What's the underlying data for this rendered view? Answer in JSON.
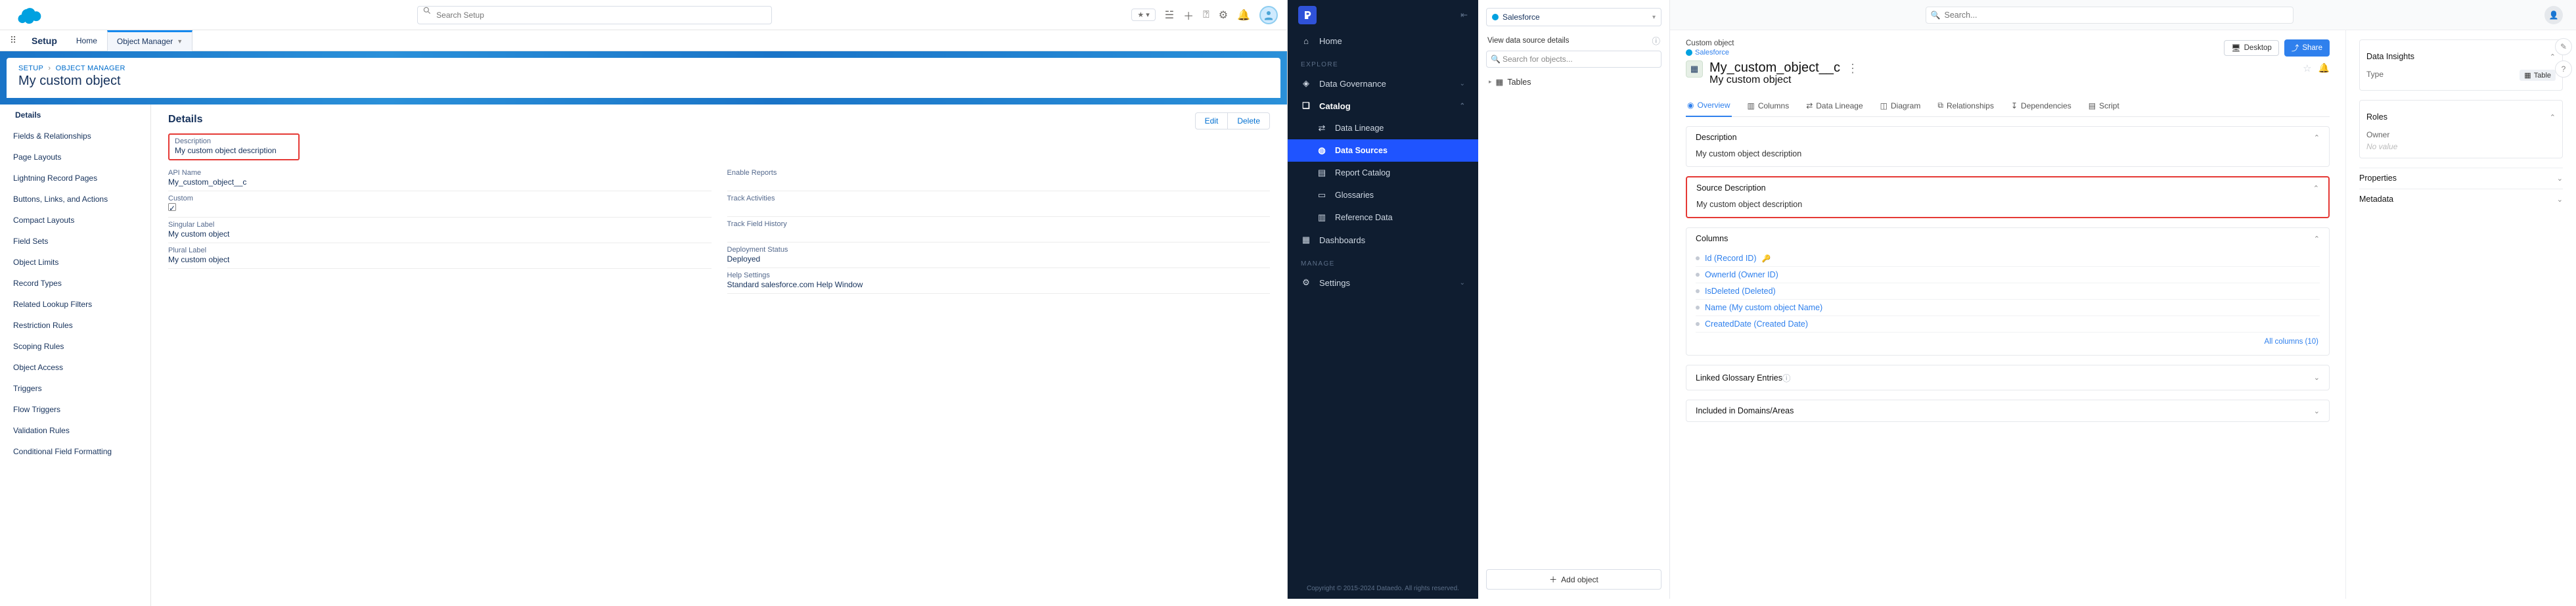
{
  "salesforce": {
    "search_placeholder": "Search Setup",
    "app_name": "Setup",
    "top_tabs": {
      "home": "Home",
      "object_manager": "Object Manager"
    },
    "star_pill": "★ ▾",
    "breadcrumb": {
      "setup": "SETUP",
      "om": "OBJECT MANAGER"
    },
    "object_title": "My custom object",
    "side_items": [
      "Details",
      "Fields & Relationships",
      "Page Layouts",
      "Lightning Record Pages",
      "Buttons, Links, and Actions",
      "Compact Layouts",
      "Field Sets",
      "Object Limits",
      "Record Types",
      "Related Lookup Filters",
      "Restriction Rules",
      "Scoping Rules",
      "Object Access",
      "Triggers",
      "Flow Triggers",
      "Validation Rules",
      "Conditional Field Formatting"
    ],
    "section_title": "Details",
    "actions": {
      "edit": "Edit",
      "delete": "Delete"
    },
    "fields": {
      "description": {
        "label": "Description",
        "value": "My custom object description"
      },
      "api_name": {
        "label": "API Name",
        "value": "My_custom_object__c"
      },
      "custom": {
        "label": "Custom"
      },
      "singular": {
        "label": "Singular Label",
        "value": "My custom object"
      },
      "plural": {
        "label": "Plural Label",
        "value": "My custom object"
      },
      "enable_reports": {
        "label": "Enable Reports"
      },
      "track_activities": {
        "label": "Track Activities"
      },
      "track_history": {
        "label": "Track Field History"
      },
      "deploy": {
        "label": "Deployment Status",
        "value": "Deployed"
      },
      "help": {
        "label": "Help Settings",
        "value": "Standard salesforce.com Help Window"
      }
    }
  },
  "alation": {
    "nav": {
      "home": "Home",
      "explore": "EXPLORE",
      "data_gov": "Data Governance",
      "catalog": "Catalog",
      "data_lineage": "Data Lineage",
      "data_sources": "Data Sources",
      "report_catalog": "Report Catalog",
      "glossaries": "Glossaries",
      "reference_data": "Reference Data",
      "dashboards": "Dashboards",
      "manage": "MANAGE",
      "settings": "Settings",
      "footer": "Copyright © 2015-2024 Dataedo. All rights reserved."
    },
    "search_placeholder": "Search...",
    "obj_panel": {
      "source": "Salesforce",
      "header": "View data source details",
      "search_placeholder": "Search for objects...",
      "tables_node": "Tables",
      "add_object": "Add object"
    },
    "header": {
      "type_label": "Custom object",
      "source_crumb": "Salesforce",
      "api_name": "My_custom_object__c",
      "display_name": "My custom object",
      "buttons": {
        "desktop": "Desktop",
        "share": "Share"
      }
    },
    "tabs": {
      "overview": "Overview",
      "columns": "Columns",
      "lineage": "Data Lineage",
      "diagram": "Diagram",
      "relationships": "Relationships",
      "dependencies": "Dependencies",
      "script": "Script"
    },
    "cards": {
      "description": {
        "title": "Description",
        "value": "My custom object description"
      },
      "source_description": {
        "title": "Source Description",
        "value": "My custom object description"
      },
      "columns": {
        "title": "Columns",
        "items": [
          {
            "name": "Id (Record ID)",
            "pk": true
          },
          {
            "name": "OwnerId (Owner ID)",
            "pk": false
          },
          {
            "name": "IsDeleted (Deleted)",
            "pk": false
          },
          {
            "name": "Name (My custom object Name)",
            "pk": false
          },
          {
            "name": "CreatedDate (Created Date)",
            "pk": false
          }
        ],
        "all_columns": "All columns (10)"
      },
      "glossary": {
        "title": "Linked Glossary Entries"
      },
      "domains": {
        "title": "Included in Domains/Areas"
      }
    },
    "aside": {
      "insights": {
        "title": "Data Insights",
        "type_label": "Type",
        "type_value": "Table"
      },
      "roles": {
        "title": "Roles",
        "owner_label": "Owner",
        "owner_value": "No value"
      },
      "properties": {
        "title": "Properties"
      },
      "metadata": {
        "title": "Metadata"
      }
    }
  }
}
